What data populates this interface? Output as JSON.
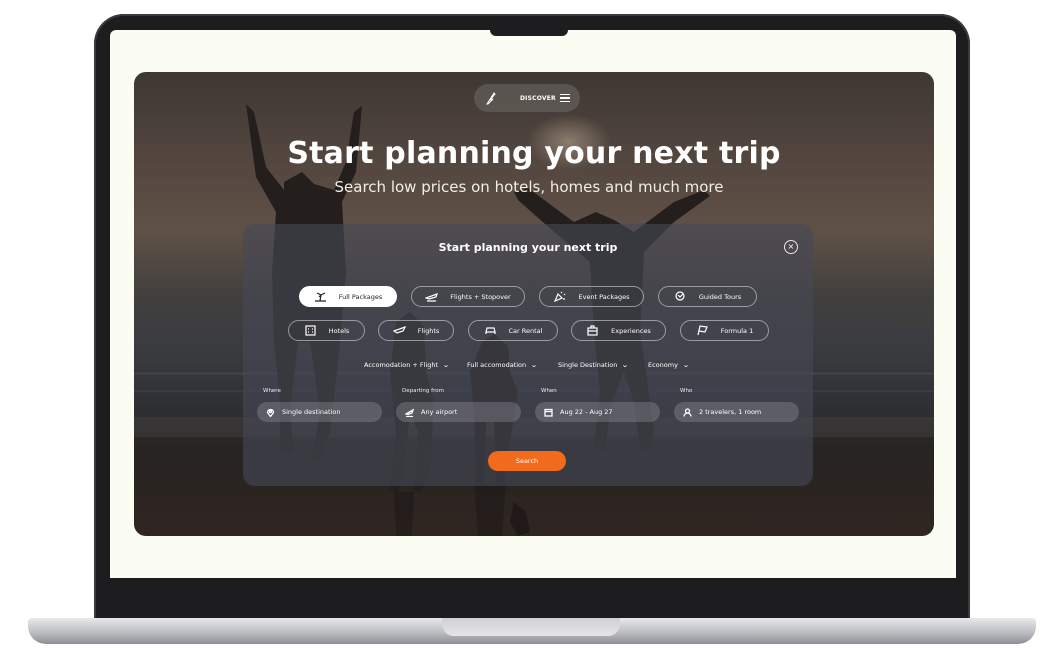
{
  "nav": {
    "discover_label": "DISCOVER",
    "logo_icon": "feather-icon",
    "menu_icon": "hamburger-icon"
  },
  "hero": {
    "title": "Start planning your next trip",
    "subtitle": "Search low prices on hotels, homes and much more"
  },
  "panel": {
    "title": "Start planning your next trip",
    "close_label": "×",
    "categories_row1": [
      {
        "label": "Full Packages",
        "icon": "island-icon",
        "active": true
      },
      {
        "label": "Flights + Stopover",
        "icon": "plane-icon",
        "active": false
      },
      {
        "label": "Event Packages",
        "icon": "confetti-icon",
        "active": false
      },
      {
        "label": "Guided Tours",
        "icon": "map-pin-icon",
        "active": false
      }
    ],
    "categories_row2": [
      {
        "label": "Hotels",
        "icon": "hotel-icon",
        "active": false
      },
      {
        "label": "Flights",
        "icon": "plane-icon",
        "active": false
      },
      {
        "label": "Car Rental",
        "icon": "car-icon",
        "active": false
      },
      {
        "label": "Experiences",
        "icon": "luggage-icon",
        "active": false
      },
      {
        "label": "Formula 1",
        "icon": "checkered-flag-icon",
        "active": false
      }
    ],
    "filters": [
      {
        "label": "Accomodation + Flight"
      },
      {
        "label": "Full accomodation"
      },
      {
        "label": "Single Destination"
      },
      {
        "label": "Economy"
      }
    ],
    "fields": [
      {
        "label": "Where",
        "value": "Single destination",
        "icon": "location-pin-icon"
      },
      {
        "label": "Departing from",
        "value": "Any airport",
        "icon": "plane-takeoff-icon"
      },
      {
        "label": "When",
        "value": "Aug 22 - Aug 27",
        "icon": "calendar-icon"
      },
      {
        "label": "Who",
        "value": "2 travelers, 1 room",
        "icon": "person-icon"
      }
    ],
    "search_label": "Search"
  },
  "colors": {
    "accent": "#f26a1b",
    "panel_bg": "#464855",
    "text": "#ffffff"
  }
}
